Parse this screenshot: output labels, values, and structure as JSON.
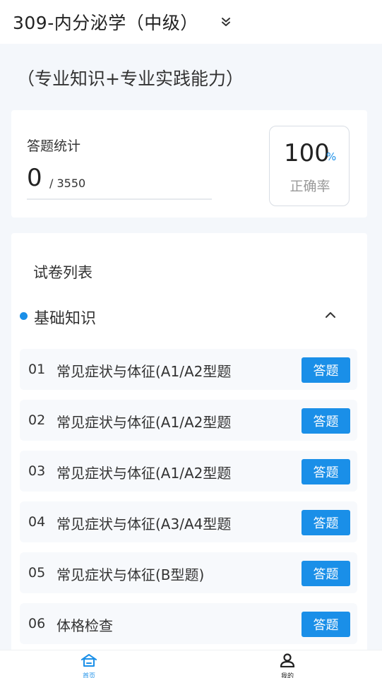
{
  "header": {
    "title": "309-内分泌学（中级）"
  },
  "subtitle": "（专业知识+专业实践能力）",
  "stats": {
    "label": "答题统计",
    "answered": "0",
    "total": "/ 3550",
    "accuracy_value": "100",
    "accuracy_unit": "%",
    "accuracy_label": "正确率"
  },
  "exam_list": {
    "title": "试卷列表",
    "section": {
      "label": "基础知识",
      "expanded": true
    },
    "items": [
      {
        "num": "01",
        "title": "常见症状与体征(A1/A2型题",
        "action": "答题"
      },
      {
        "num": "02",
        "title": "常见症状与体征(A1/A2型题",
        "action": "答题"
      },
      {
        "num": "03",
        "title": "常见症状与体征(A1/A2型题",
        "action": "答题"
      },
      {
        "num": "04",
        "title": "常见症状与体征(A3/A4型题",
        "action": "答题"
      },
      {
        "num": "05",
        "title": "常见症状与体征(B型题)",
        "action": "答题"
      },
      {
        "num": "06",
        "title": "体格检查",
        "action": "答题"
      }
    ]
  },
  "tabbar": {
    "home_label": "首页",
    "me_label": "我的",
    "active_color": "#1a8fe8"
  },
  "colors": {
    "accent": "#1a8fe8",
    "background": "#f4f7fb"
  }
}
